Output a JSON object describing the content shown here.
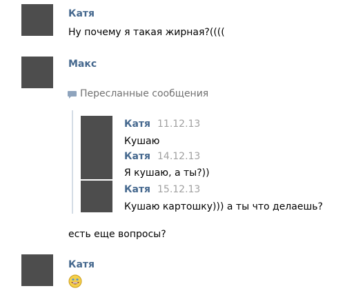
{
  "messages": [
    {
      "author": "Катя",
      "text": "Ну почему я такая жирная?(((("
    },
    {
      "author": "Макс",
      "forwarded_label": "Пересланные сообщения",
      "forwarded": [
        {
          "author": "Катя",
          "date": "11.12.13",
          "text": "Кушаю"
        },
        {
          "author": "Катя",
          "date": "14.12.13",
          "text": "Я кушаю, а ты?))"
        },
        {
          "author": "Катя",
          "date": "15.12.13",
          "text": "Кушаю картошку))) а ты что делаешь?"
        }
      ],
      "text": "есть еще вопросы?"
    },
    {
      "author": "Катя",
      "emoji": "smiling-face-emoji"
    }
  ],
  "colors": {
    "author_name": "#45688e",
    "date": "#a0a0a0",
    "avatar_placeholder": "#4d4d4d",
    "quote_bar": "#d5dde6",
    "forward_label": "#707070"
  }
}
